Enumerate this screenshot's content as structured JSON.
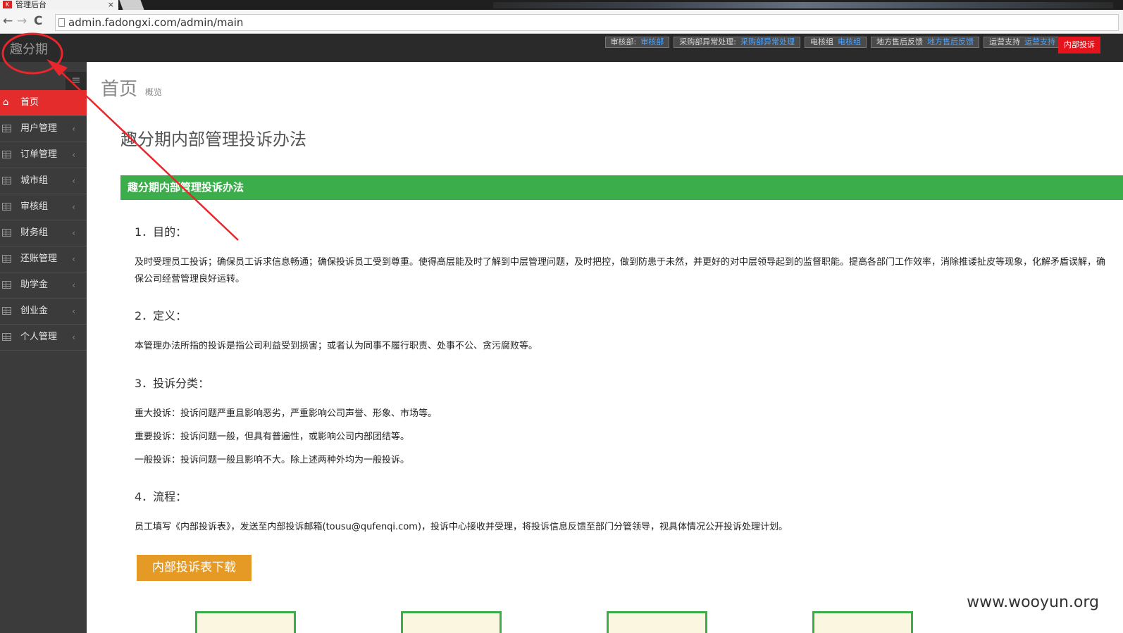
{
  "browser": {
    "tab_title": "管理后台",
    "tab_close": "×",
    "back": "←",
    "forward": "→",
    "reload": "C",
    "url": "admin.fadongxi.com/admin/main"
  },
  "header": {
    "logo": "趣分期",
    "links": [
      {
        "label": "审核部:",
        "link": "审核部"
      },
      {
        "label": "采购部异常处理:",
        "link": "采购部异常处理"
      },
      {
        "label": "电核组",
        "link": "电核组"
      },
      {
        "label": "地方售后反馈",
        "link": "地方售后反馈"
      },
      {
        "label": "运营支持",
        "link": "运营支持"
      }
    ],
    "complaint_button": "内部投诉"
  },
  "sidebar": {
    "toggle_icon": "≡",
    "items": [
      {
        "label": "首页",
        "icon": "home-icon"
      },
      {
        "label": "用户管理",
        "icon": "table-icon"
      },
      {
        "label": "订单管理",
        "icon": "table-icon"
      },
      {
        "label": "城市组",
        "icon": "table-icon"
      },
      {
        "label": "审核组",
        "icon": "table-icon"
      },
      {
        "label": "财务组",
        "icon": "table-icon"
      },
      {
        "label": "还账管理",
        "icon": "table-icon"
      },
      {
        "label": "助学金",
        "icon": "table-icon"
      },
      {
        "label": "创业金",
        "icon": "table-icon"
      },
      {
        "label": "个人管理",
        "icon": "grid-icon"
      }
    ],
    "arrow": "‹"
  },
  "content": {
    "page_title": "首页",
    "page_subtitle": "概览",
    "doc_title": "趣分期内部管理投诉办法",
    "banner": "趣分期内部管理投诉办法",
    "sections": {
      "s1_title": "1．目的：",
      "s1_body": "及时受理员工投诉；确保员工诉求信息畅通；确保投诉员工受到尊重。使得高层能及时了解到中层管理问题，及时把控，做到防患于未然，并更好的对中层领导起到的监督职能。提高各部门工作效率，消除推诿扯皮等现象，化解矛盾误解，确保公司经营管理良好运转。",
      "s2_title": "2．定义：",
      "s2_body": "本管理办法所指的投诉是指公司利益受到损害；或者认为同事不履行职责、处事不公、贪污腐败等。",
      "s3_title": "3．投诉分类：",
      "s3_items": [
        "重大投诉：投诉问题严重且影响恶劣，严重影响公司声誉、形象、市场等。",
        "重要投诉：投诉问题一般，但具有普遍性，或影响公司内部团结等。",
        "一般投诉：投诉问题一般且影响不大。除上述两种外均为一般投诉。"
      ],
      "s4_title": "4．流程：",
      "s4_body": "员工填写《内部投诉表》，发送至内部投诉邮箱(tousu@qufenqi.com)，投诉中心接收并受理，将投诉信息反馈至部门分管领导，视具体情况公开投诉处理计划。"
    },
    "download_button": "内部投诉表下载"
  },
  "watermark": "www.wooyun.org",
  "colors": {
    "accent_red": "#e42c2c",
    "banner_green": "#3bae4b",
    "button_orange": "#e59a26",
    "annotation_red": "#e8262b"
  }
}
